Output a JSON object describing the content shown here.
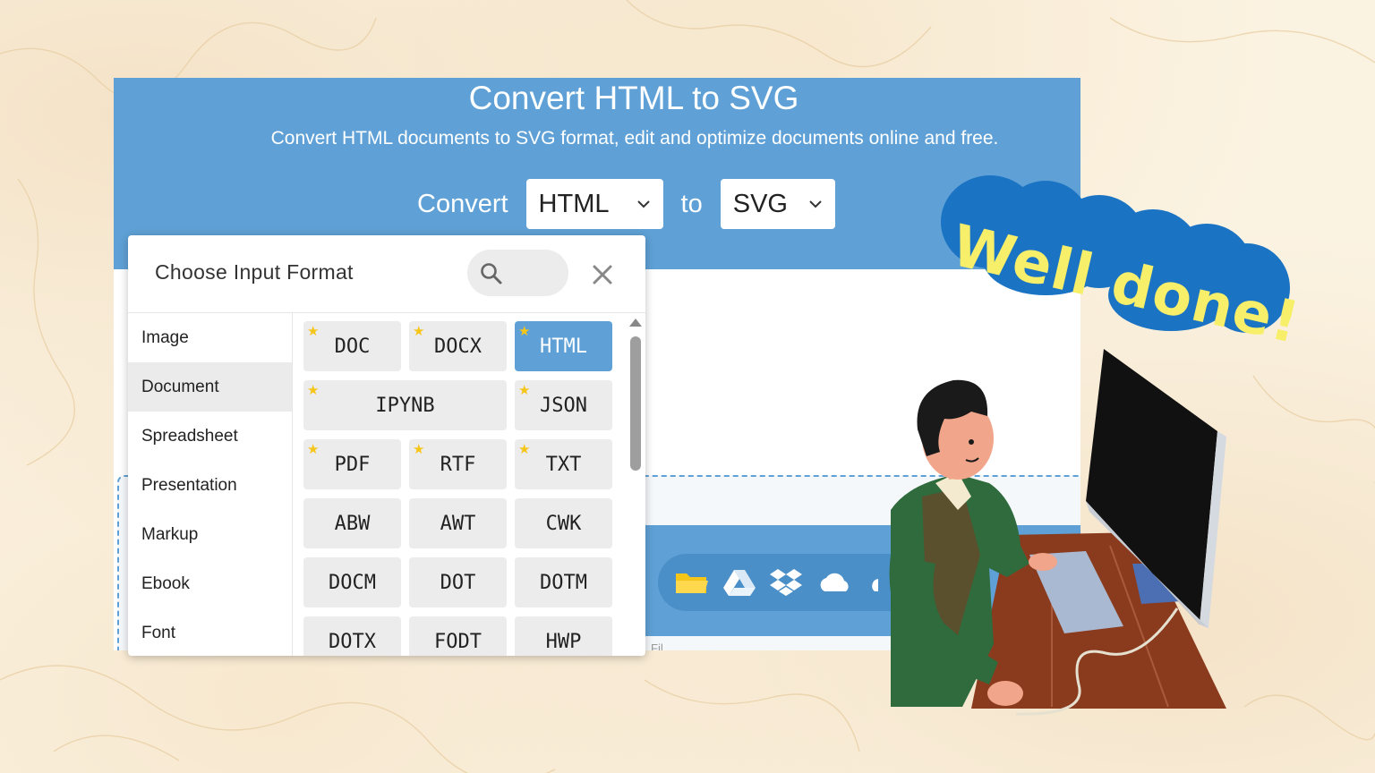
{
  "page": {
    "title": "Convert HTML to SVG",
    "subtitle": "Convert HTML documents to SVG format, edit and optimize documents online and free."
  },
  "converter": {
    "convert_label": "Convert",
    "from_value": "HTML",
    "to_label": "to",
    "to_value": "SVG"
  },
  "dropdown": {
    "title": "Choose Input Format",
    "categories": [
      "Image",
      "Document",
      "Spreadsheet",
      "Presentation",
      "Markup",
      "Ebook",
      "Font"
    ],
    "active_category": "Document",
    "formats": [
      "DOC",
      "DOCX",
      "HTML",
      "IPYNB",
      "JSON",
      "PDF",
      "RTF",
      "TXT",
      "ABW",
      "AWT",
      "CWK",
      "DOCM",
      "DOT",
      "DOTM",
      "DOTX",
      "FODT",
      "HWP"
    ],
    "starred": [
      "DOC",
      "DOCX",
      "HTML",
      "IPYNB",
      "JSON",
      "PDF",
      "RTF",
      "TXT"
    ],
    "selected": "HTML"
  },
  "upload_bar": {
    "icons": [
      "folder-icon",
      "google-drive-icon",
      "dropbox-icon",
      "onedrive-icon"
    ],
    "faint_label": "Fil"
  },
  "sticker": {
    "text": "Well done!"
  },
  "colors": {
    "accent": "#5fa1d6",
    "sticker_blue": "#1b73c4",
    "sticker_text": "#f7ef6a",
    "star": "#f5c518",
    "background": "#fbf3e2"
  }
}
